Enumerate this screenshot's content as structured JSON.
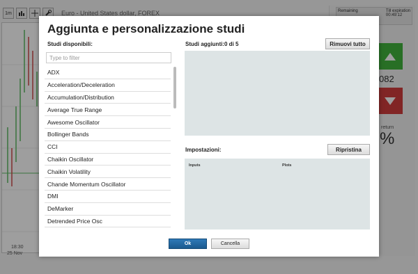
{
  "background": {
    "toolbar_buttons": [
      "1m",
      "bar-chart-icon",
      "crosshair-icon",
      "wrench-icon"
    ],
    "instrument": "Euro - United States dollar, FOREX",
    "price_box": {
      "left": "Remaining",
      "right_label": "Till expiration",
      "right_value": "00:49:12"
    },
    "value": "082",
    "return_label": "return",
    "return_value": "%",
    "xaxis": {
      "time": "18:30",
      "date": "25 Nov"
    }
  },
  "dialog": {
    "title": "Aggiunta e personalizzazione studi",
    "available_label": "Studi disponibili:",
    "filter_placeholder": "Type to filter",
    "studies": [
      "ADX",
      "Acceleration/Deceleration",
      "Accumulation/Distribution",
      "Average True Range",
      "Awesome Oscillator",
      "Bollinger Bands",
      "CCI",
      "Chaikin Oscillator",
      "Chaikin Volatility",
      "Chande Momentum Oscillator",
      "DMI",
      "DeMarker",
      "Detrended Price Osc"
    ],
    "added_label": "Studi aggiunti:0 di 5",
    "remove_all": "Rimuovi tutto",
    "settings_label": "Impostazioni:",
    "reset": "Ripristina",
    "inputs_label": "Inputs",
    "plots_label": "Plots",
    "ok": "Ok",
    "cancel": "Cancella"
  },
  "colors": {
    "ok_button": "#1f66a3",
    "panel_bg": "#dde4e5",
    "up": "#41b33c",
    "down": "#d03c3c"
  }
}
